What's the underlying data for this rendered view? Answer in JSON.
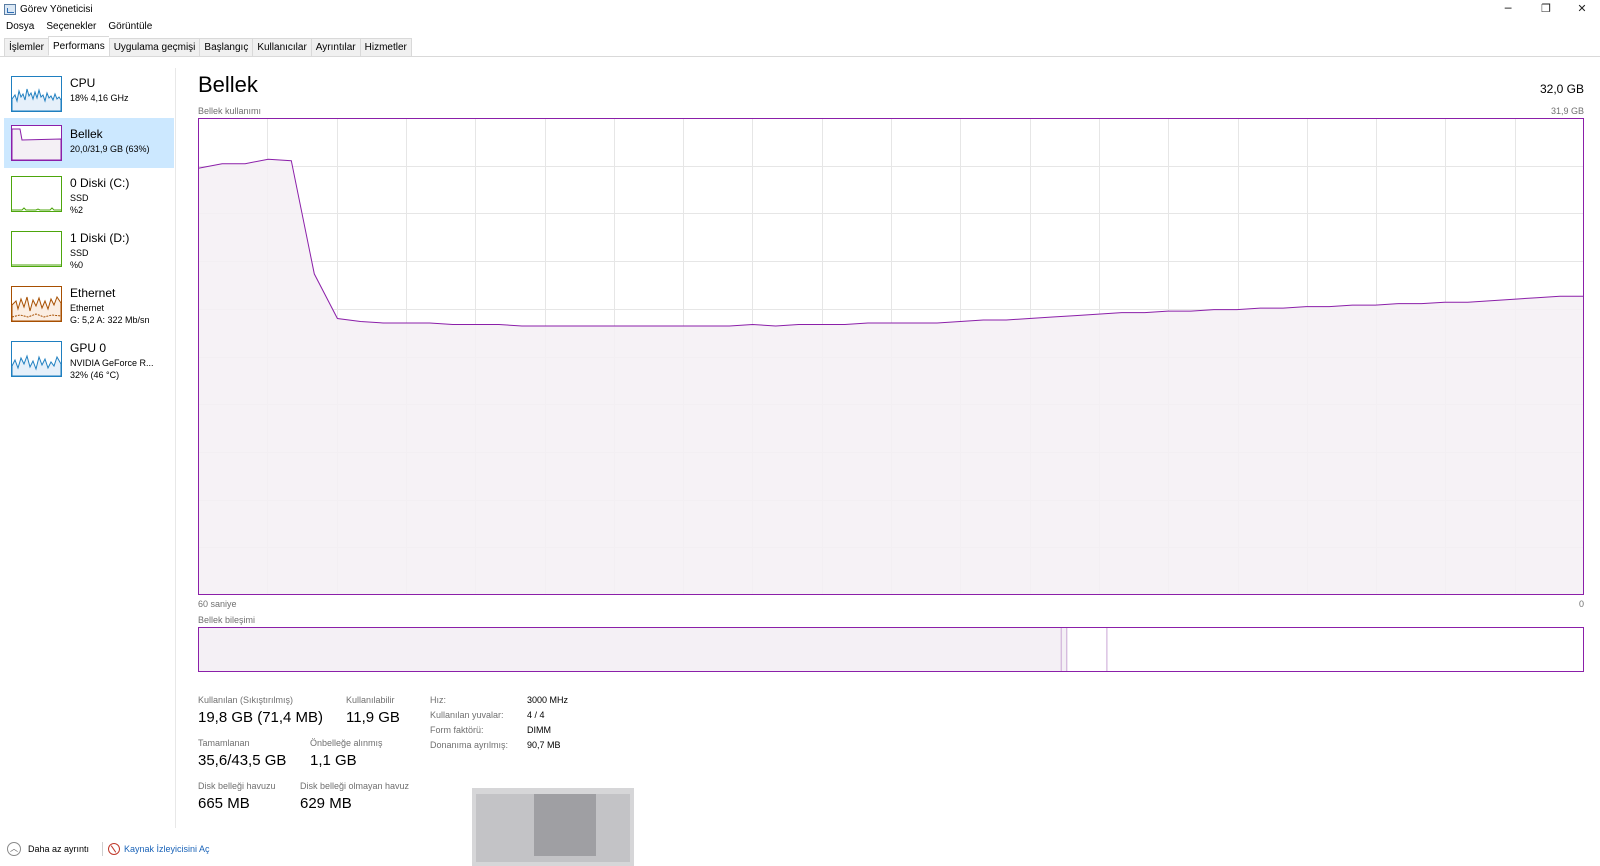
{
  "window": {
    "title": "Görev Yöneticisi",
    "controls": {
      "minimize": "─",
      "restore": "❐",
      "close": "✕"
    }
  },
  "menu": [
    "Dosya",
    "Seçenekler",
    "Görüntüle"
  ],
  "tabs": [
    {
      "label": "İşlemler",
      "active": false
    },
    {
      "label": "Performans",
      "active": true
    },
    {
      "label": "Uygulama geçmişi",
      "active": false
    },
    {
      "label": "Başlangıç",
      "active": false
    },
    {
      "label": "Kullanıcılar",
      "active": false
    },
    {
      "label": "Ayrıntılar",
      "active": false
    },
    {
      "label": "Hizmetler",
      "active": false
    }
  ],
  "sidebar": {
    "items": [
      {
        "title": "CPU",
        "lines": [
          "18% 4,16 GHz"
        ],
        "color": "#1f7fc0",
        "selected": false
      },
      {
        "title": "Bellek",
        "lines": [
          "20,0/31,9 GB (63%)"
        ],
        "color": "#8b1fa9",
        "selected": true
      },
      {
        "title": "0 Diski (C:)",
        "lines": [
          "SSD",
          "%2"
        ],
        "color": "#4da60c",
        "selected": false
      },
      {
        "title": "1 Diski (D:)",
        "lines": [
          "SSD",
          "%0"
        ],
        "color": "#4da60c",
        "selected": false
      },
      {
        "title": "Ethernet",
        "lines": [
          "Ethernet",
          "G: 5,2 A: 322 Mb/sn"
        ],
        "color": "#a74f01",
        "selected": false
      },
      {
        "title": "GPU 0",
        "lines": [
          "NVIDIA GeForce R...",
          "32% (46 °C)"
        ],
        "color": "#1f7fc0",
        "selected": false
      }
    ]
  },
  "main": {
    "title": "Bellek",
    "total": "32,0 GB",
    "usage_label": "Bellek kullanımı",
    "usage_max": "31,9 GB",
    "time_start": "60 saniye",
    "time_end": "0",
    "composition_label": "Bellek bileşimi"
  },
  "stats": {
    "in_use_label": "Kullanılan (Sıkıştırılmış)",
    "in_use_value": "19,8 GB (71,4 MB)",
    "available_label": "Kullanılabilir",
    "available_value": "11,9 GB",
    "committed_label": "Tamamlanan",
    "committed_value": "35,6/43,5 GB",
    "cached_label": "Önbelleğe alınmış",
    "cached_value": "1,1 GB",
    "paged_label": "Disk belleği havuzu",
    "paged_value": "665 MB",
    "nonpaged_label": "Disk belleği olmayan havuz",
    "nonpaged_value": "629 MB"
  },
  "specs": [
    {
      "label": "Hız:",
      "value": "3000 MHz"
    },
    {
      "label": "Kullanılan yuvalar:",
      "value": "4 / 4"
    },
    {
      "label": "Form faktörü:",
      "value": "DIMM"
    },
    {
      "label": "Donanıma ayrılmış:",
      "value": "90,7 MB"
    }
  ],
  "footer": {
    "less_detail": "Daha az ayrıntı",
    "resmon": "Kaynak İzleyicisini Aç"
  },
  "chart_data": {
    "type": "area",
    "title": "Bellek kullanımı",
    "xlabel": "",
    "ylabel": "",
    "x": [
      60,
      59,
      58,
      57,
      56,
      55,
      54,
      53,
      52,
      51,
      50,
      49,
      48,
      47,
      46,
      45,
      44,
      43,
      42,
      41,
      40,
      39,
      38,
      37,
      36,
      35,
      34,
      33,
      32,
      31,
      30,
      29,
      28,
      27,
      26,
      25,
      24,
      23,
      22,
      21,
      20,
      19,
      18,
      17,
      16,
      15,
      14,
      13,
      12,
      11,
      10,
      9,
      8,
      7,
      6,
      5,
      4,
      3,
      2,
      1,
      0
    ],
    "series": [
      {
        "values": [
          28.6,
          28.9,
          28.9,
          29.2,
          29.1,
          21.5,
          18.5,
          18.3,
          18.2,
          18.2,
          18.2,
          18.1,
          18.1,
          18.1,
          18.0,
          18.0,
          18.0,
          18.0,
          18.0,
          18.0,
          18.0,
          18.0,
          18.0,
          18.0,
          18.1,
          18.0,
          18.1,
          18.1,
          18.1,
          18.2,
          18.2,
          18.2,
          18.2,
          18.3,
          18.4,
          18.4,
          18.5,
          18.6,
          18.7,
          18.8,
          18.9,
          18.9,
          19.0,
          19.0,
          19.1,
          19.1,
          19.2,
          19.2,
          19.3,
          19.3,
          19.4,
          19.4,
          19.5,
          19.5,
          19.6,
          19.6,
          19.7,
          19.8,
          19.9,
          20.0,
          20.0
        ]
      }
    ],
    "ylim": [
      0,
      31.9
    ],
    "xlim": [
      60,
      0
    ],
    "grid": true,
    "line_color": "#8b1fa9",
    "fill_color": "#f4f0f5",
    "composition": {
      "in_use_fraction": 0.623,
      "modified_fraction": 0.004,
      "standby_fraction": 0.029,
      "free_fraction": 0.344
    }
  }
}
